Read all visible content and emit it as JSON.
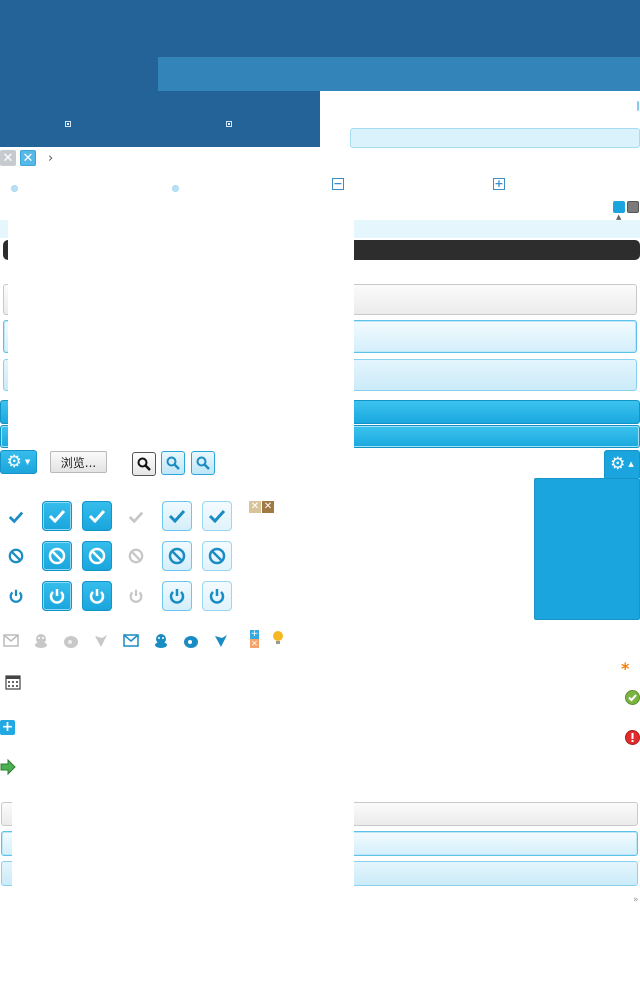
{
  "toolbar": {
    "browse_label": "浏览...",
    "breadcrumb_sep": "›"
  },
  "colors": {
    "header_dark": "#236398",
    "header_band": "#3385b9",
    "accent": "#1ba5df",
    "dark_bar": "#2d2d2d",
    "orange_star": "#f07f0b",
    "ok_green": "#7cb342",
    "error_red": "#e02c2c",
    "arrow_green": "#4caf50"
  },
  "icons": {
    "close_gray": "close-icon",
    "close_blue": "close-icon",
    "breadcrumb": "chevron-right-icon",
    "minus_box": "minus-box-icon",
    "plus_box": "plus-box-icon",
    "gear": "gear-icon",
    "search": "search-icon",
    "check": "check-icon",
    "ban": "ban-icon",
    "power": "power-icon",
    "mail": "mail-icon",
    "qq": "qq-icon",
    "weibo": "weibo-icon",
    "tencent_weibo": "tencent-weibo-icon",
    "bulb": "lightbulb-icon",
    "calendar": "calendar-icon",
    "add": "add-icon",
    "arrow": "arrow-right-icon",
    "star": "required-star-icon",
    "ok": "ok-circle-icon",
    "error": "error-circle-icon"
  },
  "footer": {
    "corner_mark": "»"
  }
}
